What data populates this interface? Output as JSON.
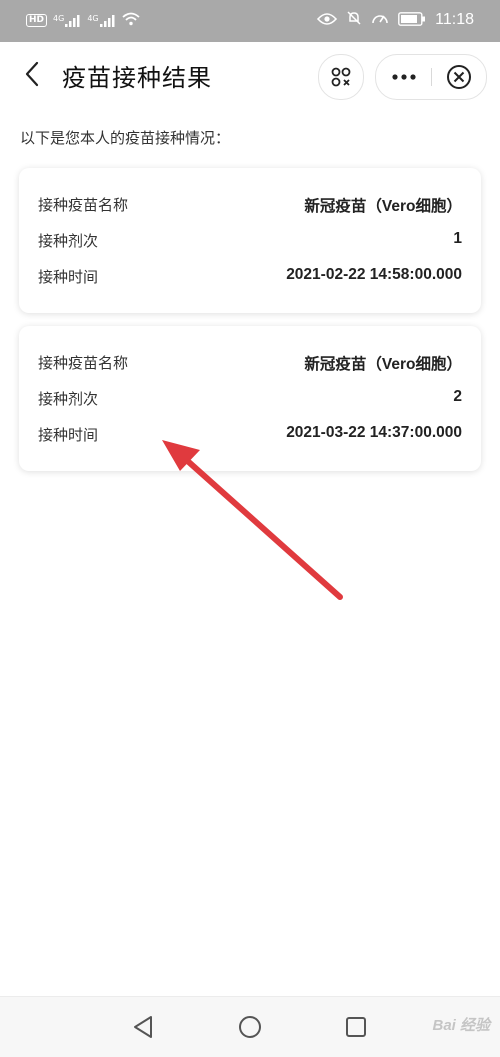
{
  "status_bar": {
    "hd_badge": "HD",
    "network_1": "4G",
    "network_2": "4G",
    "time": "11:18",
    "icons": [
      "hd-icon",
      "signal-icon",
      "signal-icon",
      "wifi-icon",
      "eye-icon",
      "mute-bell-icon",
      "speed-icon",
      "battery-icon"
    ]
  },
  "nav": {
    "title": "疫苗接种结果"
  },
  "intro_text": "以下是您本人的疫苗接种情况：",
  "records": [
    {
      "name_label": "接种疫苗名称",
      "name_value": "新冠疫苗（Vero细胞）",
      "dose_label": "接种剂次",
      "dose_value": "1",
      "time_label": "接种时间",
      "time_value": "2021-02-22 14:58:00.000"
    },
    {
      "name_label": "接种疫苗名称",
      "name_value": "新冠疫苗（Vero细胞）",
      "dose_label": "接种剂次",
      "dose_value": "2",
      "time_label": "接种时间",
      "time_value": "2021-03-22 14:37:00.000"
    }
  ],
  "watermark": "Bai 经验",
  "colors": {
    "status_bar": "#a9a9a9",
    "annotation_arrow": "#e03a3e",
    "card_bg": "#ffffff"
  }
}
